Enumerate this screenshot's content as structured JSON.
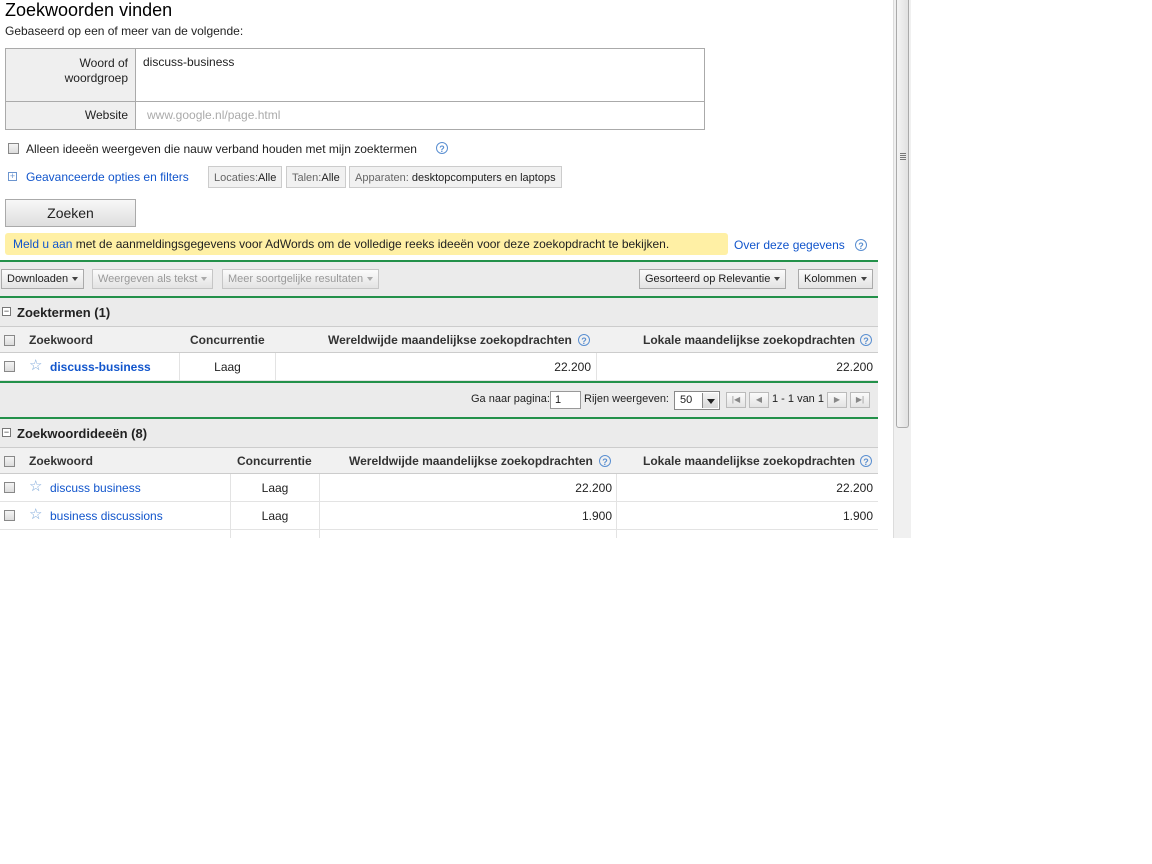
{
  "header": {
    "title": "Zoekwoorden vinden",
    "subtitle": "Gebaseerd op een of meer van de volgende:"
  },
  "form": {
    "word_label_line1": "Woord of",
    "word_label_line2": "woordgroep",
    "word_value": "discuss-business",
    "website_label": "Website",
    "website_placeholder": "www.google.nl/page.html"
  },
  "options": {
    "close_ideas_label": "Alleen ideeën weergeven die nauw verband houden met mijn zoektermen",
    "advanced_link": "Geavanceerde opties en filters",
    "locations_label": "Locaties:",
    "locations_value": "Alle",
    "languages_label": "Talen:",
    "languages_value": "Alle",
    "devices_label": "Apparaten:",
    "devices_value": "desktopcomputers en laptops"
  },
  "search_button": "Zoeken",
  "notice": {
    "link": "Meld u aan",
    "text": " met de aanmeldingsgegevens voor AdWords om de volledige reeks ideeën voor deze zoekopdracht te bekijken.",
    "about_link": "Over deze gegevens"
  },
  "toolbar": {
    "download": "Downloaden",
    "view_as_text": "Weergeven als tekst",
    "more_similar": "Meer soortgelijke resultaten",
    "sorted": "Gesorteerd op Relevantie",
    "columns": "Kolommen"
  },
  "search_terms": {
    "title": "Zoektermen (1)",
    "headers": {
      "keyword": "Zoekwoord",
      "competition": "Concurrentie",
      "global": "Wereldwijde maandelijkse zoekopdrachten",
      "local": "Lokale maandelijkse zoekopdrachten"
    },
    "rows": [
      {
        "keyword": "discuss-business",
        "competition": "Laag",
        "global": "22.200",
        "local": "22.200"
      }
    ]
  },
  "pager": {
    "goto_label": "Ga naar pagina:",
    "page_value": "1",
    "rows_label": "Rijen weergeven:",
    "rows_value": "50",
    "range": "1 - 1 van 1"
  },
  "ideas": {
    "title": "Zoekwoordideeën (8)",
    "headers": {
      "keyword": "Zoekwoord",
      "competition": "Concurrentie",
      "global": "Wereldwijde maandelijkse zoekopdrachten",
      "local": "Lokale maandelijkse zoekopdrachten"
    },
    "rows": [
      {
        "keyword": "discuss business",
        "competition": "Laag",
        "global": "22.200",
        "local": "22.200"
      },
      {
        "keyword": "business discussions",
        "competition": "Laag",
        "global": "1.900",
        "local": "1.900"
      }
    ]
  },
  "colors": {
    "link": "#1155cc",
    "notice_bg": "#fff0a5",
    "divider_green": "#23914a"
  }
}
